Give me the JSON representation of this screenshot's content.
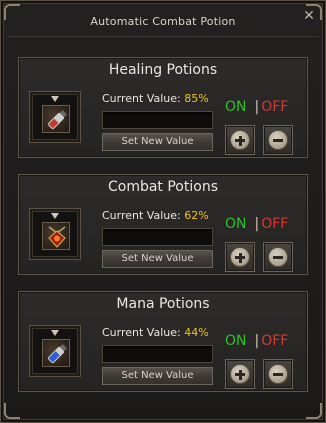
{
  "window": {
    "title": "Automatic Combat Potion",
    "close_glyph": "✕"
  },
  "panels": [
    {
      "title": "Healing Potions",
      "current_value_label": "Current Value:",
      "current_value": "85%",
      "input_value": "",
      "set_button_label": "Set New Value",
      "on_label": "ON",
      "separator": "|",
      "off_label": "OFF",
      "item_icon": "healing-potion-vial-icon"
    },
    {
      "title": "Combat Potions",
      "current_value_label": "Current Value:",
      "current_value": "62%",
      "input_value": "",
      "set_button_label": "Set New Value",
      "on_label": "ON",
      "separator": "|",
      "off_label": "OFF",
      "item_icon": "combat-potion-amulet-icon"
    },
    {
      "title": "Mana Potions",
      "current_value_label": "Current Value:",
      "current_value": "44%",
      "input_value": "",
      "set_button_label": "Set New Value",
      "on_label": "ON",
      "separator": "|",
      "off_label": "OFF",
      "item_icon": "mana-potion-vial-icon"
    }
  ],
  "colors": {
    "on": "#2fbf2f",
    "off": "#cf3c34",
    "value": "#f0c21b"
  }
}
